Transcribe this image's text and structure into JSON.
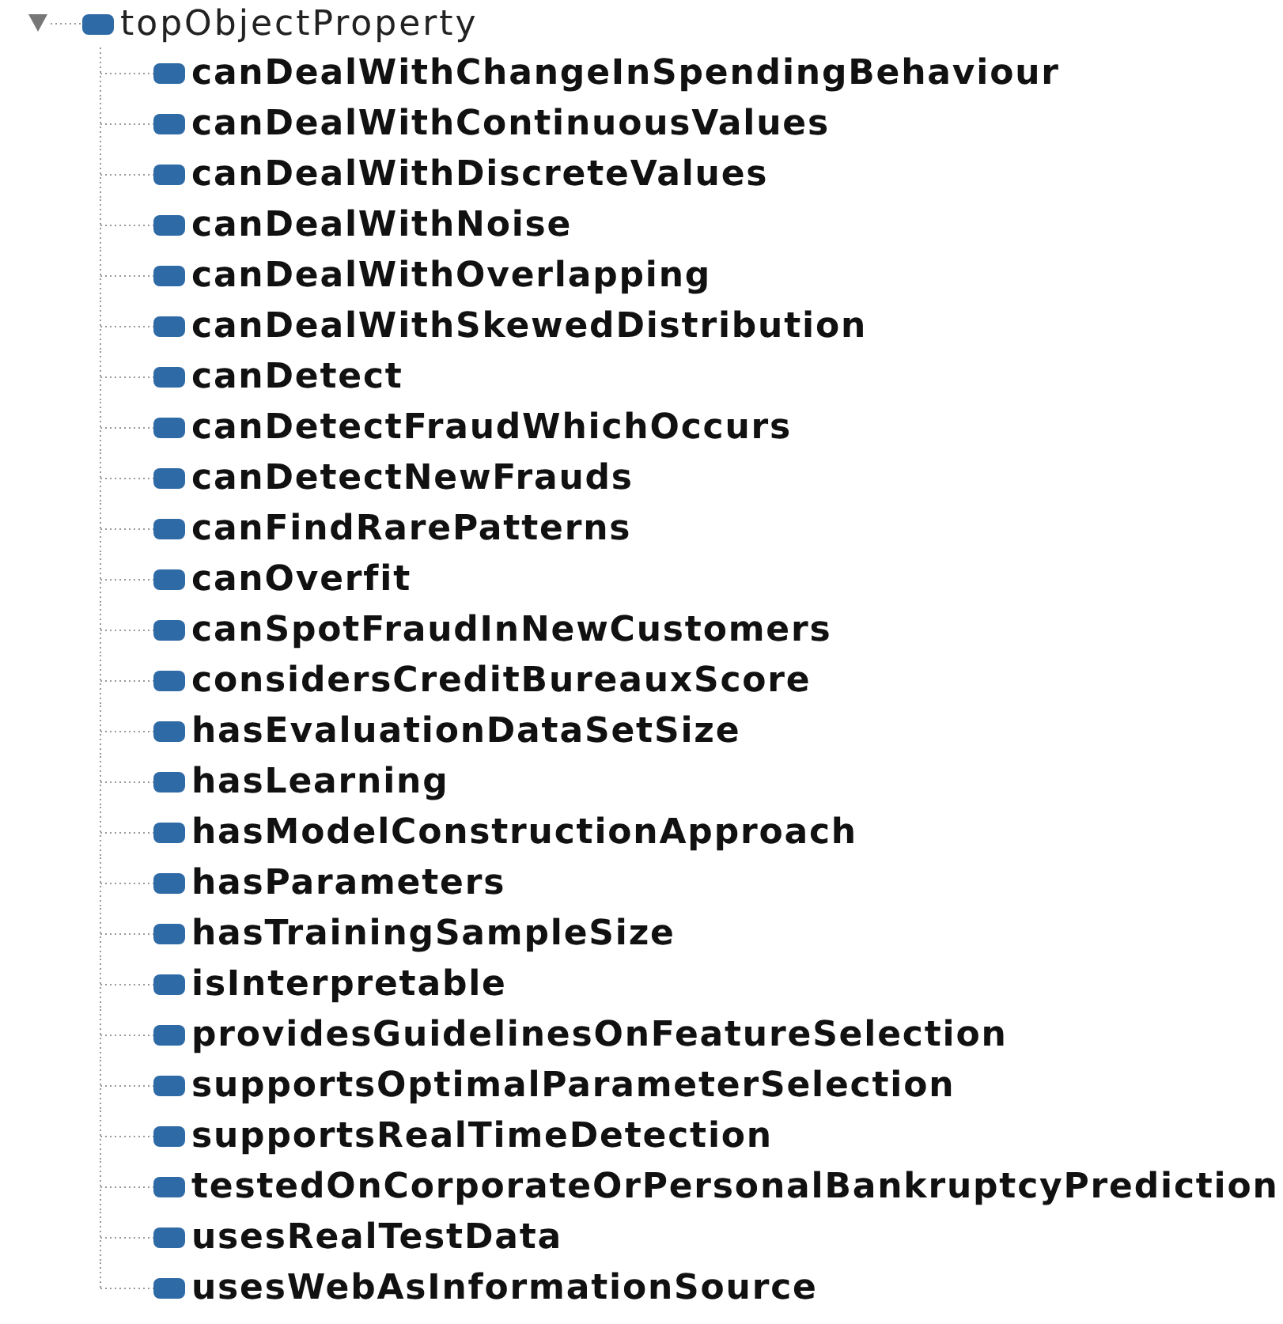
{
  "tree": {
    "label": "topObjectProperty",
    "expanded": true,
    "children": [
      {
        "label": "canDealWithChangeInSpendingBehaviour"
      },
      {
        "label": "canDealWithContinuousValues"
      },
      {
        "label": "canDealWithDiscreteValues"
      },
      {
        "label": "canDealWithNoise"
      },
      {
        "label": "canDealWithOverlapping"
      },
      {
        "label": "canDealWithSkewedDistribution"
      },
      {
        "label": "canDetect"
      },
      {
        "label": "canDetectFraudWhichOccurs"
      },
      {
        "label": "canDetectNewFrauds"
      },
      {
        "label": "canFindRarePatterns"
      },
      {
        "label": "canOverfit"
      },
      {
        "label": "canSpotFraudInNewCustomers"
      },
      {
        "label": "considersCreditBureauxScore"
      },
      {
        "label": "hasEvaluationDataSetSize"
      },
      {
        "label": "hasLearning"
      },
      {
        "label": "hasModelConstructionApproach"
      },
      {
        "label": "hasParameters"
      },
      {
        "label": "hasTrainingSampleSize"
      },
      {
        "label": "isInterpretable"
      },
      {
        "label": "providesGuidelinesOnFeatureSelection"
      },
      {
        "label": "supportsOptimalParameterSelection"
      },
      {
        "label": "supportsRealTimeDetection"
      },
      {
        "label": "testedOnCorporateOrPersonalBankruptcyPrediction"
      },
      {
        "label": "usesRealTestData"
      },
      {
        "label": "usesWebAsInformationSource"
      }
    ]
  }
}
